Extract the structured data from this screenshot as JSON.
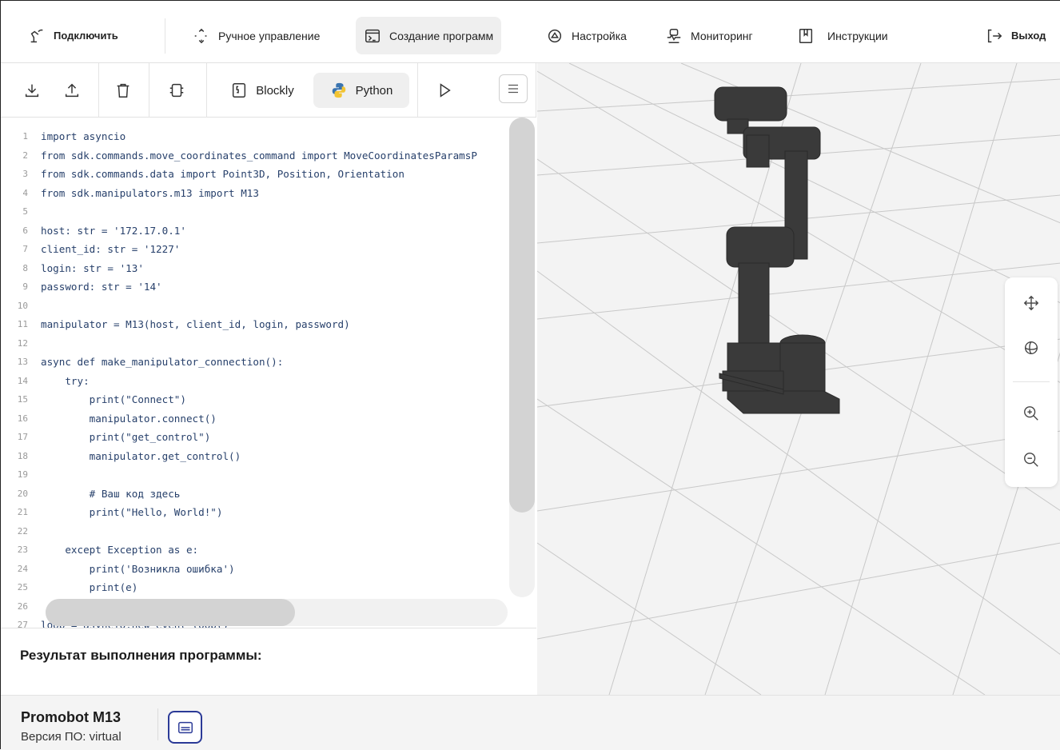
{
  "nav": {
    "connect": "Подключить",
    "manual": "Ручное управление",
    "create": "Создание программ",
    "settings": "Настройка",
    "monitoring": "Мониторинг",
    "instructions": "Инструкции",
    "exit": "Выход"
  },
  "toolbar": {
    "blockly": "Blockly",
    "python": "Python"
  },
  "code": {
    "lines": [
      {
        "n": "1",
        "t": "import asyncio"
      },
      {
        "n": "2",
        "t": "from sdk.commands.move_coordinates_command import MoveCoordinatesParamsP"
      },
      {
        "n": "3",
        "t": "from sdk.commands.data import Point3D, Position, Orientation"
      },
      {
        "n": "4",
        "t": "from sdk.manipulators.m13 import M13"
      },
      {
        "n": "5",
        "t": ""
      },
      {
        "n": "6",
        "t": "host: str = '172.17.0.1'"
      },
      {
        "n": "7",
        "t": "client_id: str = '1227'"
      },
      {
        "n": "8",
        "t": "login: str = '13'"
      },
      {
        "n": "9",
        "t": "password: str = '14'"
      },
      {
        "n": "10",
        "t": ""
      },
      {
        "n": "11",
        "t": "manipulator = M13(host, client_id, login, password)"
      },
      {
        "n": "12",
        "t": ""
      },
      {
        "n": "13",
        "t": "async def make_manipulator_connection():"
      },
      {
        "n": "14",
        "t": "    try:"
      },
      {
        "n": "15",
        "t": "        print(\"Connect\")"
      },
      {
        "n": "16",
        "t": "        manipulator.connect()"
      },
      {
        "n": "17",
        "t": "        print(\"get_control\")"
      },
      {
        "n": "18",
        "t": "        manipulator.get_control()"
      },
      {
        "n": "19",
        "t": ""
      },
      {
        "n": "20",
        "t": "        # Ваш код здесь"
      },
      {
        "n": "21",
        "t": "        print(\"Hello, World!\")"
      },
      {
        "n": "22",
        "t": ""
      },
      {
        "n": "23",
        "t": "    except Exception as e:"
      },
      {
        "n": "24",
        "t": "        print('Возникла ошибка')"
      },
      {
        "n": "25",
        "t": "        print(e)"
      },
      {
        "n": "26",
        "t": ""
      },
      {
        "n": "27",
        "t": "loop = asyncio.new_event_loop()"
      }
    ]
  },
  "result": {
    "title": "Результат выполнения программы:"
  },
  "footer": {
    "robot_name": "Promobot M13",
    "version": "Версия ПО: virtual"
  },
  "icons": {
    "connect": "robot-arm-icon",
    "manual": "move-icon",
    "create": "terminal-icon",
    "settings": "settings-icon",
    "monitoring": "monitoring-icon",
    "instructions": "bookmark-icon",
    "exit": "logout-icon",
    "download": "download-icon",
    "upload": "upload-icon",
    "delete": "trash-icon",
    "chip": "chip-icon",
    "blockly": "blockly-icon",
    "python": "python-icon",
    "run": "play-icon",
    "menu": "menu-icon",
    "pan": "pan-icon",
    "rotate": "rotate-icon",
    "zoom_in": "zoom-in-icon",
    "zoom_out": "zoom-out-icon",
    "console": "console-icon"
  },
  "colors": {
    "accent": "#2b3a97",
    "code_text": "#27406b",
    "robot": "#3a3a3a",
    "viewport_bg": "#f3f3f3"
  }
}
